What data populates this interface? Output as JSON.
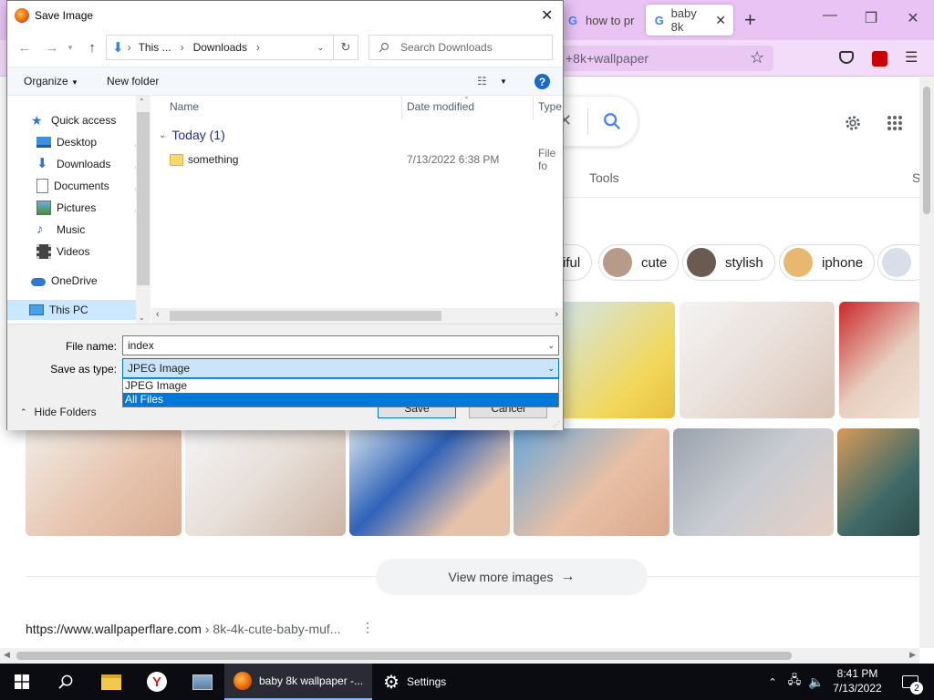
{
  "browser": {
    "tabs": [
      {
        "label": "how to pr"
      },
      {
        "label": "baby 8k"
      }
    ],
    "url_text": "+8k+wallpaper",
    "tools_label": "Tools",
    "s_label": "S",
    "chips": [
      {
        "label": "iful"
      },
      {
        "label": "cute"
      },
      {
        "label": "stylish"
      },
      {
        "label": "iphone"
      }
    ],
    "view_more": "View more images",
    "result_url": "https://www.wallpaperflare.com",
    "result_path": " › 8k-4k-cute-baby-muf..."
  },
  "dialog": {
    "title": "Save Image",
    "breadcrumb": [
      "This ...",
      "Downloads"
    ],
    "search_placeholder": "Search Downloads",
    "organize": "Organize",
    "new_folder": "New folder",
    "nav": {
      "quick_access": "Quick access",
      "items": [
        {
          "label": "Desktop",
          "icon": "desktop-icon"
        },
        {
          "label": "Downloads",
          "icon": "download-arrow-icon"
        },
        {
          "label": "Documents",
          "icon": "document-icon"
        },
        {
          "label": "Pictures",
          "icon": "pictures-icon"
        },
        {
          "label": "Music",
          "icon": "music-note-icon"
        },
        {
          "label": "Videos",
          "icon": "film-icon"
        }
      ],
      "onedrive": "OneDrive",
      "this_pc": "This PC"
    },
    "columns": {
      "name": "Name",
      "date": "Date modified",
      "type": "Type"
    },
    "group": "Today (1)",
    "files": [
      {
        "name": "something",
        "date": "7/13/2022 6:38 PM",
        "type": "File fo"
      }
    ],
    "file_name_label": "File name:",
    "file_name_value": "index",
    "save_type_label": "Save as type:",
    "save_type_value": "JPEG Image",
    "type_options": [
      "JPEG Image",
      "All Files"
    ],
    "hide_folders": "Hide Folders",
    "save_button": "Save",
    "cancel_button": "Cancel"
  },
  "taskbar": {
    "firefox_label": "baby 8k wallpaper -...",
    "settings_label": "Settings",
    "time": "8:41 PM",
    "date": "7/13/2022",
    "notification_count": "2"
  },
  "colors": {
    "firefox_tabbar": "#e8c3f3",
    "accent": "#0078d7",
    "taskbar": "#0b0b12"
  }
}
